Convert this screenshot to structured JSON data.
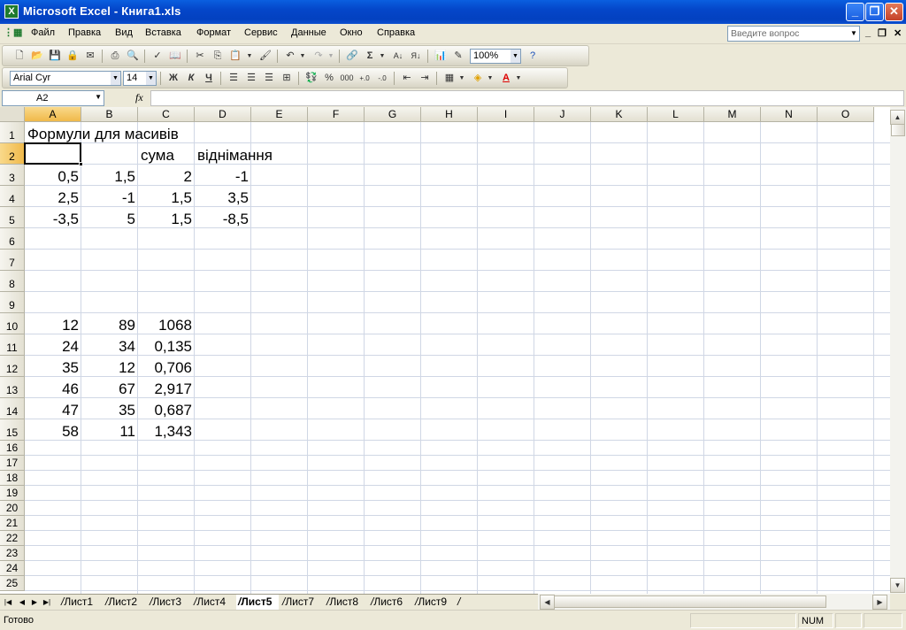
{
  "app": {
    "title": "Microsoft Excel - Книга1.xls"
  },
  "menu": {
    "items": [
      "Файл",
      "Правка",
      "Вид",
      "Вставка",
      "Формат",
      "Сервис",
      "Данные",
      "Окно",
      "Справка"
    ],
    "ask_placeholder": "Введите вопрос"
  },
  "toolbar": {
    "zoom": "100%",
    "font_name": "Arial Cyr",
    "font_size": "14",
    "bold_label": "Ж",
    "italic_label": "К",
    "underline_label": "Ч",
    "percent_label": "%",
    "thousands_label": "000",
    "sum_label": "Σ"
  },
  "formula_bar": {
    "name_box": "A2",
    "fx": "fx",
    "formula": ""
  },
  "columns": [
    "A",
    "B",
    "C",
    "D",
    "E",
    "F",
    "G",
    "H",
    "I",
    "J",
    "K",
    "L",
    "M",
    "N",
    "O"
  ],
  "selected_column": "A",
  "selected_row": "2",
  "rows": [
    "1",
    "2",
    "3",
    "4",
    "5",
    "6",
    "7",
    "8",
    "9",
    "10",
    "11",
    "12",
    "13",
    "14",
    "15",
    "16",
    "17",
    "18",
    "19",
    "20",
    "21",
    "22",
    "23",
    "24",
    "25"
  ],
  "cells": {
    "A1": "Формули для масивів",
    "C2": "сума",
    "D2": "віднімання",
    "A3": "0,5",
    "B3": "1,5",
    "C3": "2",
    "D3": "-1",
    "A4": "2,5",
    "B4": "-1",
    "C4": "1,5",
    "D4": "3,5",
    "A5": "-3,5",
    "B5": "5",
    "C5": "1,5",
    "D5": "-8,5",
    "A10": "12",
    "B10": "89",
    "C10": "1068",
    "A11": "24",
    "B11": "34",
    "C11": "0,135",
    "A12": "35",
    "B12": "12",
    "C12": "0,706",
    "A13": "46",
    "B13": "67",
    "C13": "2,917",
    "A14": "47",
    "B14": "35",
    "C14": "0,687",
    "A15": "58",
    "B15": "11",
    "C15": "1,343"
  },
  "sheets": [
    "Лист1",
    "Лист2",
    "Лист3",
    "Лист4",
    "Лист5",
    "Лист7",
    "Лист8",
    "Лист6",
    "Лист9"
  ],
  "active_sheet": "Лист5",
  "status": {
    "text": "Готово",
    "num": "NUM"
  }
}
